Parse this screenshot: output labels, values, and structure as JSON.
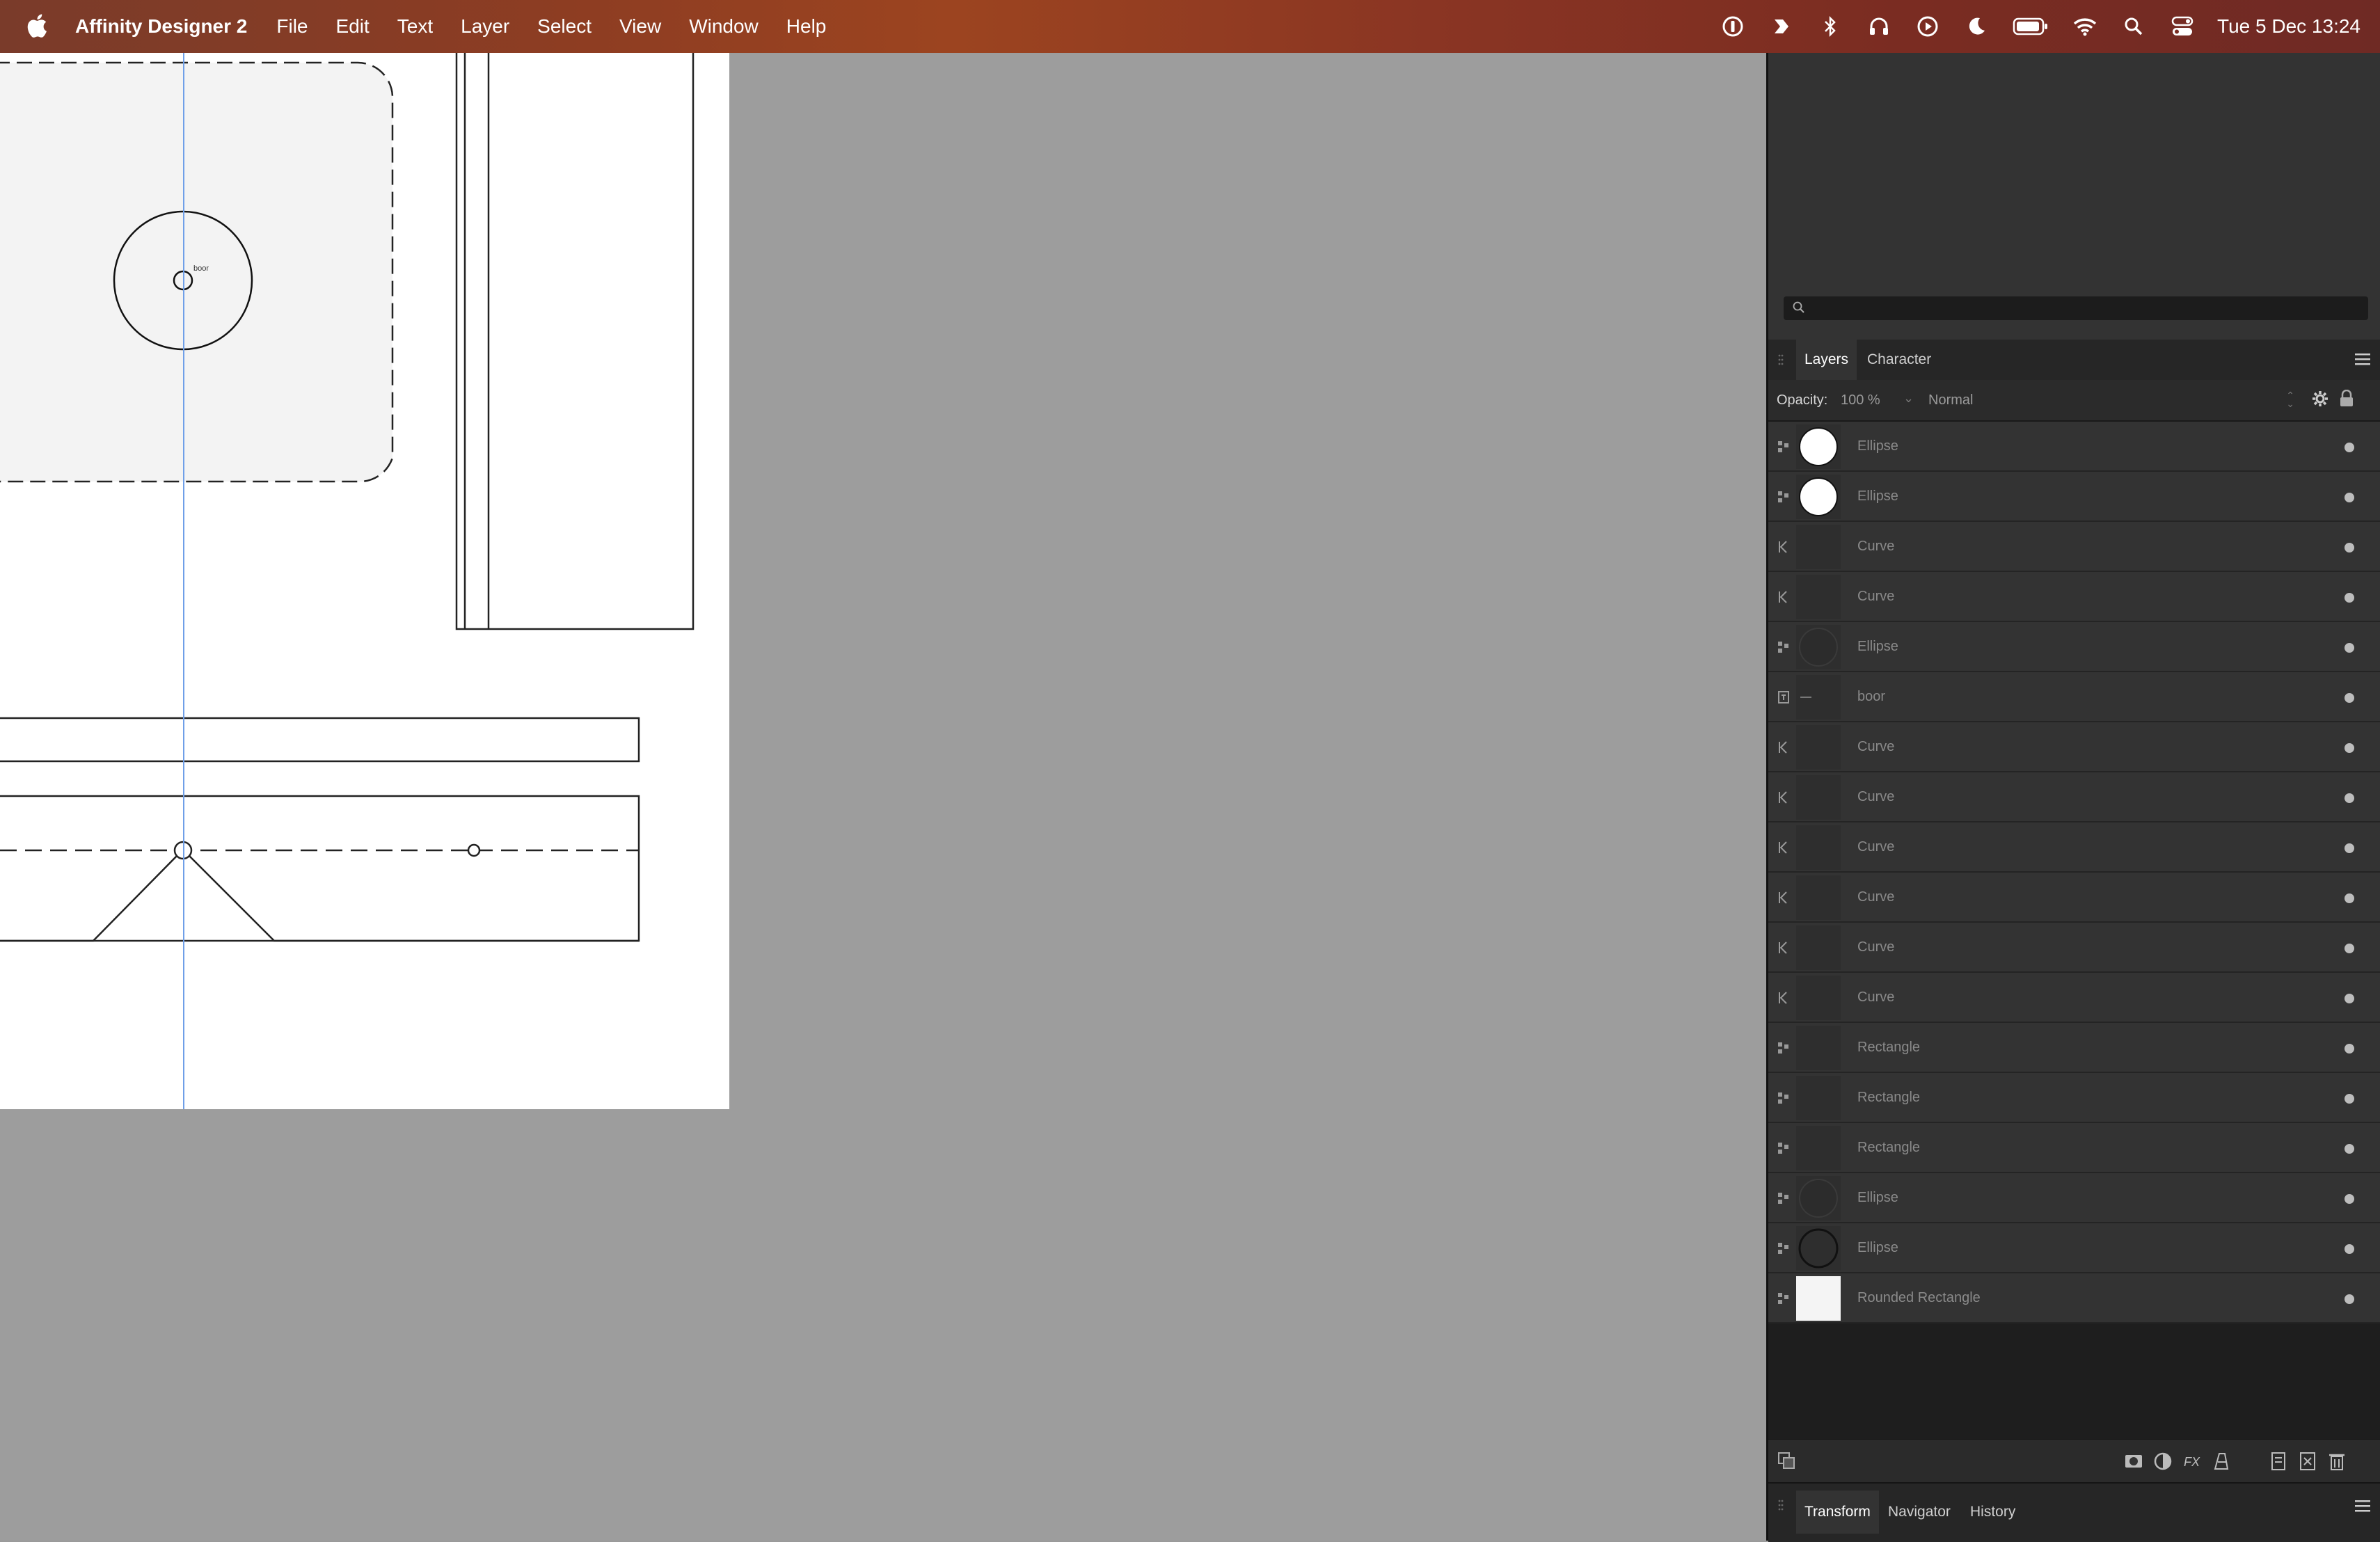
{
  "menubar": {
    "app_name": "Affinity Designer 2",
    "menus": [
      "File",
      "Edit",
      "Text",
      "Layer",
      "Select",
      "View",
      "Window",
      "Help"
    ],
    "status_icons": [
      "onepassword-icon",
      "shortcut-icon",
      "bluetooth-icon",
      "headphones-icon",
      "play-icon",
      "moon-icon",
      "battery-icon",
      "wifi-icon",
      "spotlight-search-icon",
      "control-center-icon"
    ],
    "clock": "Tue 5 Dec 13:24"
  },
  "canvas": {
    "small_text": "boor"
  },
  "panel": {
    "search_placeholder": "",
    "tabs": [
      "Layers",
      "Character"
    ],
    "active_tab": "Layers",
    "opacity_label": "Opacity:",
    "opacity_value": "100 %",
    "blend_mode": "Normal",
    "layers": [
      {
        "name": "Ellipse",
        "kind": "shape",
        "thumb": "white-circle"
      },
      {
        "name": "Ellipse",
        "kind": "shape",
        "thumb": "white-circle"
      },
      {
        "name": "Curve",
        "kind": "curve",
        "thumb": "none"
      },
      {
        "name": "Curve",
        "kind": "curve",
        "thumb": "none"
      },
      {
        "name": "Ellipse",
        "kind": "shape",
        "thumb": "dark-circle"
      },
      {
        "name": "boor",
        "kind": "text",
        "thumb": "text-line"
      },
      {
        "name": "Curve",
        "kind": "curve",
        "thumb": "none"
      },
      {
        "name": "Curve",
        "kind": "curve",
        "thumb": "none"
      },
      {
        "name": "Curve",
        "kind": "curve",
        "thumb": "none"
      },
      {
        "name": "Curve",
        "kind": "curve",
        "thumb": "none"
      },
      {
        "name": "Curve",
        "kind": "curve",
        "thumb": "none"
      },
      {
        "name": "Curve",
        "kind": "curve",
        "thumb": "none"
      },
      {
        "name": "Rectangle",
        "kind": "shape",
        "thumb": "none"
      },
      {
        "name": "Rectangle",
        "kind": "shape",
        "thumb": "none"
      },
      {
        "name": "Rectangle",
        "kind": "shape",
        "thumb": "none"
      },
      {
        "name": "Ellipse",
        "kind": "shape",
        "thumb": "dark-circle"
      },
      {
        "name": "Ellipse",
        "kind": "shape",
        "thumb": "outline-circle"
      },
      {
        "name": "Rounded Rectangle",
        "kind": "shape",
        "thumb": "light-rect"
      }
    ],
    "bottom_tabs": [
      "Transform",
      "Navigator",
      "History"
    ],
    "bottom_active_tab": "Transform"
  },
  "colors": {
    "guide": "#6f9fe8",
    "panel_bg": "#333333",
    "canvas_bg": "#9d9d9d"
  }
}
